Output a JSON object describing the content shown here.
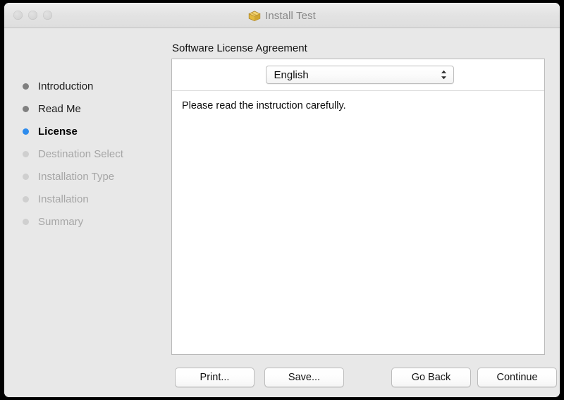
{
  "window": {
    "title": "Install Test",
    "title_icon": "package-box-icon",
    "traffic_lights": [
      {
        "name": "close-button",
        "color": "#d6d6d6"
      },
      {
        "name": "minimize-button",
        "color": "#d6d6d6"
      },
      {
        "name": "zoom-button",
        "color": "#d6d6d6"
      }
    ]
  },
  "sidebar": {
    "steps": [
      {
        "label": "Introduction",
        "state": "done"
      },
      {
        "label": "Read Me",
        "state": "done"
      },
      {
        "label": "License",
        "state": "current"
      },
      {
        "label": "Destination Select",
        "state": "pending"
      },
      {
        "label": "Installation Type",
        "state": "pending"
      },
      {
        "label": "Installation",
        "state": "pending"
      },
      {
        "label": "Summary",
        "state": "pending"
      }
    ]
  },
  "main": {
    "pane_title": "Software License Agreement",
    "language": {
      "selected": "English",
      "chevron_icon": "chevron-up-down-icon"
    },
    "license_text": "Please read the instruction carefully."
  },
  "buttons": {
    "print": "Print...",
    "save": "Save...",
    "go_back": "Go Back",
    "continue": "Continue"
  },
  "colors": {
    "window_background": "#e8e8e8",
    "titlebar_top": "#eeeeee",
    "titlebar_bottom": "#dedede",
    "content_white": "#ffffff",
    "current_step_bullet": "#2e8ced",
    "done_step_bullet": "#808080",
    "pending_step_bullet": "#cfcfcf",
    "pending_step_text": "#a6a6a6",
    "title_text": "#888888"
  }
}
